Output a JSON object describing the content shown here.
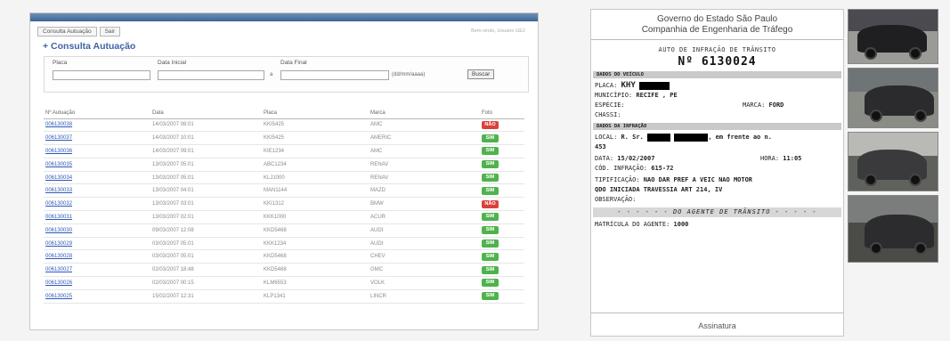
{
  "consult": {
    "menu": [
      "Consulta Autuação",
      "Sair"
    ],
    "welcome": "Bem-vindo, Usuário GE2",
    "title": "+ Consulta Autuação",
    "filters": {
      "placa_label": "Placa",
      "data_inicial_label": "Data Inicial",
      "data_final_label": "Data Final",
      "date_sep": "a",
      "date_format": "(dd/mm/aaaa)",
      "search_button": "Buscar"
    },
    "columns": [
      "Nº Autuação",
      "Data",
      "Placa",
      "Marca",
      "Foto"
    ],
    "rows": [
      {
        "num": "00613003​8",
        "data": "14/03/2007 08:01",
        "placa": "KKI5425",
        "marca": "AMC",
        "foto": "NÃO"
      },
      {
        "num": "006130037",
        "data": "14/03/2007 10:01",
        "placa": "KKI5425",
        "marca": "AMERIC",
        "foto": "SIM"
      },
      {
        "num": "006130036",
        "data": "14/03/2007 09:01",
        "placa": "KIE1234",
        "marca": "AMC",
        "foto": "SIM"
      },
      {
        "num": "006130035",
        "data": "13/03/2007 05:01",
        "placa": "ABC1234",
        "marca": "RENAV",
        "foto": "SIM"
      },
      {
        "num": "006130034",
        "data": "13/03/2007 05:01",
        "placa": "KLJ1000",
        "marca": "RENAV",
        "foto": "SIM"
      },
      {
        "num": "006130033",
        "data": "13/03/2007 04:01",
        "placa": "MAN1144",
        "marca": "MAZD",
        "foto": "SIM"
      },
      {
        "num": "006130032",
        "data": "13/03/2007 03:01",
        "placa": "KKI1312",
        "marca": "BMW",
        "foto": "NÃO"
      },
      {
        "num": "006130031",
        "data": "13/03/2007 02:01",
        "placa": "KKK1000",
        "marca": "ACUR",
        "foto": "SIM"
      },
      {
        "num": "006130030",
        "data": "09/03/2007 12:08",
        "placa": "KKD5468",
        "marca": "AUDI",
        "foto": "SIM"
      },
      {
        "num": "006130029",
        "data": "03/03/2007 05:01",
        "placa": "KKK1234",
        "marca": "AUDI",
        "foto": "SIM"
      },
      {
        "num": "006130028",
        "data": "03/03/2007 05:01",
        "placa": "KKD5468",
        "marca": "CHEV",
        "foto": "SIM"
      },
      {
        "num": "006130027",
        "data": "02/03/2007 18:48",
        "placa": "KKD5468",
        "marca": "GMC",
        "foto": "SIM"
      },
      {
        "num": "006130026",
        "data": "02/03/2007 00:15",
        "placa": "KLM6553",
        "marca": "VOLK",
        "foto": "SIM"
      },
      {
        "num": "006130025",
        "data": "15/02/2007 12:31",
        "placa": "KLP1341",
        "marca": "LINCR",
        "foto": "SIM"
      }
    ]
  },
  "ticket": {
    "gov": "Governo do Estado São Paulo",
    "company": "Companhia de Engenharia de Tráfego",
    "title": "AUTO DE INFRAÇÃO DE TRÂNSITO",
    "number": "Nº 6130024",
    "section_vehicle": "DADOS DO VEÍCULO",
    "placa_label": "PLACA:",
    "placa_value": "KHY",
    "municipio_label": "MUNICÍPIO:",
    "municipio_value": "RECIFE , PE",
    "especie_label": "ESPÉCIE:",
    "marca_label": "MARCA:",
    "marca_value": "FORD",
    "chassi_label": "CHASSI:",
    "section_infraction": "DADOS DA INFRAÇÃO",
    "local_label": "LOCAL:",
    "local_prefix": "R. Sr.",
    "local_suffix": ", em frente ao n.",
    "local_number": "453",
    "data_label": "DATA:",
    "data_value": "15/02/2007",
    "hora_label": "HORA:",
    "hora_value": "11:05",
    "cod_label": "CÓD. INFRAÇÃO:",
    "cod_value": "615-72",
    "tip_label": "TIPIFICAÇÃO:",
    "tip_value_1": "NAO DAR PREF A VEIC NAO MOTOR",
    "tip_value_2": "QDO INICIADA TRAVESSIA ART 214, IV",
    "obs_label": "OBSERVAÇÃO:",
    "agent_bar": "- - - - - - DO AGENTE DE TRÂNSITO - - - - -",
    "matricula_label": "MATRÍCULA DO AGENTE:",
    "matricula_value": "1000",
    "signature": "Assinatura"
  },
  "photos": [
    {
      "name": "photo-1",
      "car_color": "#1f1f22",
      "sky": "#4a4a50",
      "ground": "#9a9a96"
    },
    {
      "name": "photo-2",
      "car_color": "#2b2b2e",
      "sky": "#6f7576",
      "ground": "#8a8d86"
    },
    {
      "name": "photo-3",
      "car_color": "#3a3a3c",
      "sky": "#b9b9b5",
      "ground": "#5f625c"
    },
    {
      "name": "photo-4",
      "car_color": "#2c2c2f",
      "sky": "#7b7d7c",
      "ground": "#4b4b48"
    }
  ],
  "colors": {
    "link": "#2e58b8",
    "title": "#3f62a6",
    "badge_sim": "#4fb34c",
    "badge_nao": "#d9423c"
  }
}
